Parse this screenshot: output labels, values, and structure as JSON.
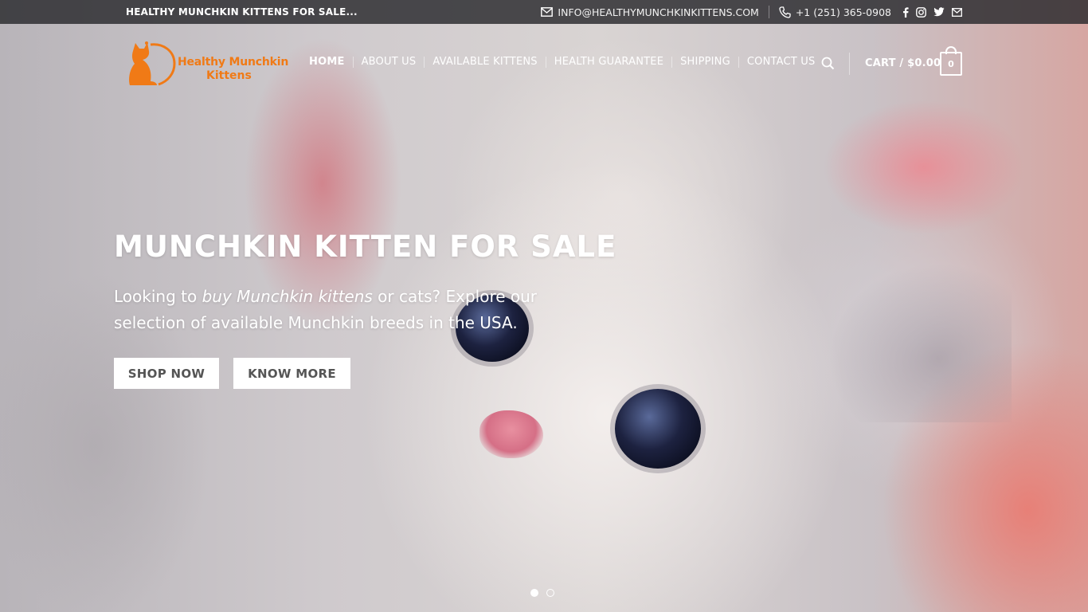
{
  "topbar": {
    "tagline": "HEALTHY MUNCHKIN KITTENS FOR SALE...",
    "email": "INFO@HEALTHYMUNCHKINKITTENS.COM",
    "phone": "+1 (251) 365-0908",
    "social_icons": [
      "facebook-icon",
      "instagram-icon",
      "twitter-icon",
      "envelope-icon"
    ]
  },
  "logo": {
    "line1": "Healthy Munchkin",
    "line2": "Kittens",
    "color": "#f07a16"
  },
  "nav": {
    "items": [
      {
        "label": "HOME",
        "active": true
      },
      {
        "label": "ABOUT US"
      },
      {
        "label": "AVAILABLE KITTENS"
      },
      {
        "label": "HEALTH GUARANTEE"
      },
      {
        "label": "SHIPPING"
      },
      {
        "label": "CONTACT US"
      }
    ]
  },
  "cart": {
    "label": "CART / $0.00",
    "count": "0"
  },
  "hero": {
    "title": "MUNCHKIN KITTEN FOR SALE",
    "text_before": "Looking to ",
    "text_emphasis": "buy Munchkin kittens",
    "text_after": " or cats? Explore our selection of available Munchkin breeds in the USA.",
    "buttons": {
      "shop": "SHOP NOW",
      "know": "KNOW MORE"
    },
    "slides": {
      "count": 2,
      "active": 1
    }
  }
}
